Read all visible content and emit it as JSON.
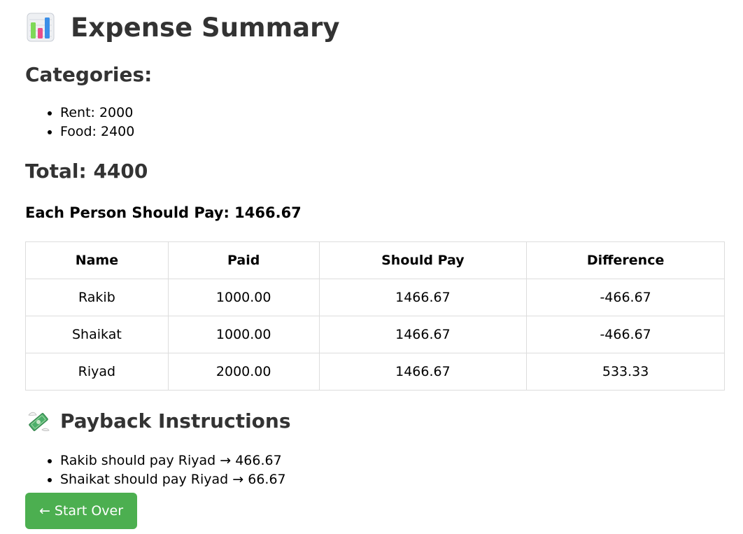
{
  "title": {
    "icon": "bar-chart-icon",
    "text": "Expense Summary"
  },
  "categories": {
    "heading": "Categories:",
    "items": [
      "Rent: 2000",
      "Food: 2400"
    ]
  },
  "total": {
    "text": "Total: 4400"
  },
  "each_person": {
    "text": "Each Person Should Pay: 1466.67"
  },
  "table": {
    "headers": [
      "Name",
      "Paid",
      "Should Pay",
      "Difference"
    ],
    "rows": [
      [
        "Rakib",
        "1000.00",
        "1466.67",
        "-466.67"
      ],
      [
        "Shaikat",
        "1000.00",
        "1466.67",
        "-466.67"
      ],
      [
        "Riyad",
        "2000.00",
        "1466.67",
        "533.33"
      ]
    ]
  },
  "payback": {
    "icon": "money-with-wings-icon",
    "heading": "Payback Instructions",
    "items": [
      "Rakib should pay Riyad → 466.67",
      "Shaikat should pay Riyad → 66.67"
    ]
  },
  "start_over": {
    "label": "← Start Over"
  },
  "colors": {
    "button_bg": "#4caf50",
    "heading_text": "#333333",
    "table_border": "#dddddd"
  }
}
